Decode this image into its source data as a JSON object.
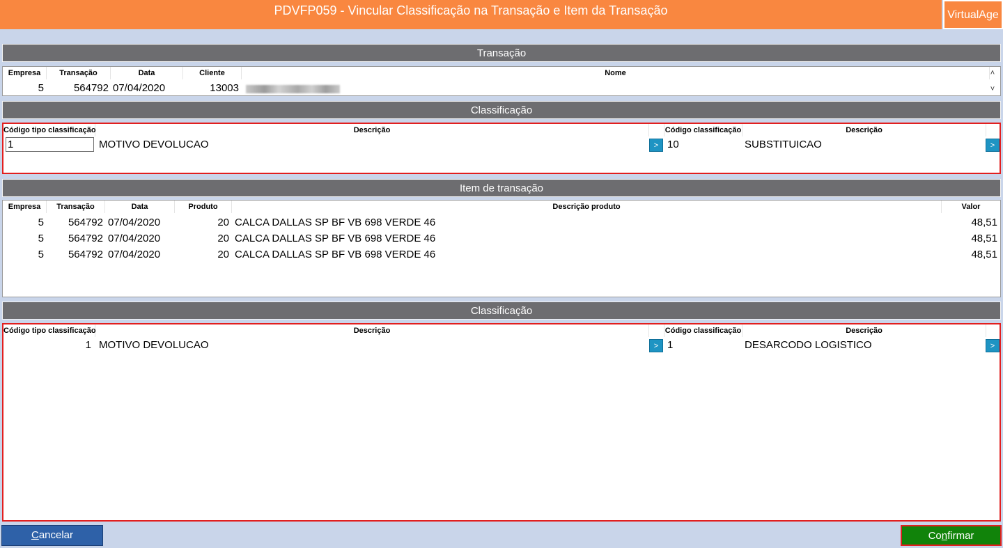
{
  "window": {
    "title": "PDVFP059 - Vincular Classificação na Transação e Item da Transação",
    "brand": "VirtualAge"
  },
  "transacao": {
    "section_title": "Transação",
    "headers": {
      "empresa": "Empresa",
      "transacao": "Transação",
      "data": "Data",
      "cliente": "Cliente",
      "nome": "Nome"
    },
    "row": {
      "empresa": "5",
      "transacao": "564792",
      "data": "07/04/2020",
      "cliente": "13003"
    }
  },
  "classificacao_top": {
    "section_title": "Classificação",
    "headers": {
      "codigo_tipo": "Código tipo classificação",
      "descricao": "Descrição",
      "codigo_classificacao": "Código classificação",
      "descricao2": "Descrição"
    },
    "row": {
      "codigo_tipo": "1",
      "descricao": "MOTIVO DEVOLUCAO",
      "codigo_classificacao": "10",
      "descricao2": "SUBSTITUICAO"
    },
    "arrow_label": ">"
  },
  "itens": {
    "section_title": "Item de transação",
    "headers": {
      "empresa": "Empresa",
      "transacao": "Transação",
      "data": "Data",
      "produto": "Produto",
      "descricao": "Descrição produto",
      "valor": "Valor"
    },
    "rows": [
      {
        "empresa": "5",
        "transacao": "564792",
        "data": "07/04/2020",
        "produto": "20",
        "descricao": "CALCA DALLAS SP BF VB 698 VERDE 46",
        "valor": "48,51"
      },
      {
        "empresa": "5",
        "transacao": "564792",
        "data": "07/04/2020",
        "produto": "20",
        "descricao": "CALCA DALLAS SP BF VB 698 VERDE 46",
        "valor": "48,51"
      },
      {
        "empresa": "5",
        "transacao": "564792",
        "data": "07/04/2020",
        "produto": "20",
        "descricao": "CALCA DALLAS SP BF VB 698 VERDE 46",
        "valor": "48,51"
      }
    ]
  },
  "classificacao_bottom": {
    "section_title": "Classificação",
    "headers": {
      "codigo_tipo": "Código tipo classificação",
      "descricao": "Descrição",
      "codigo_classificacao": "Código classificação",
      "descricao2": "Descrição"
    },
    "row": {
      "codigo_tipo": "1",
      "descricao": "MOTIVO DEVOLUCAO",
      "codigo_classificacao": "1",
      "descricao2": "DESARCODO LOGISTICO"
    },
    "arrow_label": ">"
  },
  "buttons": {
    "cancelar_first": "C",
    "cancelar_rest": "ancelar",
    "confirmar_pre": "Co",
    "confirmar_u": "n",
    "confirmar_post": "firmar"
  },
  "colors": {
    "titlebar": "#f98740",
    "section_bar": "#6d6d70",
    "background": "#c9d5ea",
    "highlight_border": "#e21f1f",
    "arrow_button": "#1e94c3",
    "cancel_button": "#2e61a8",
    "confirm_button": "#11830a"
  }
}
